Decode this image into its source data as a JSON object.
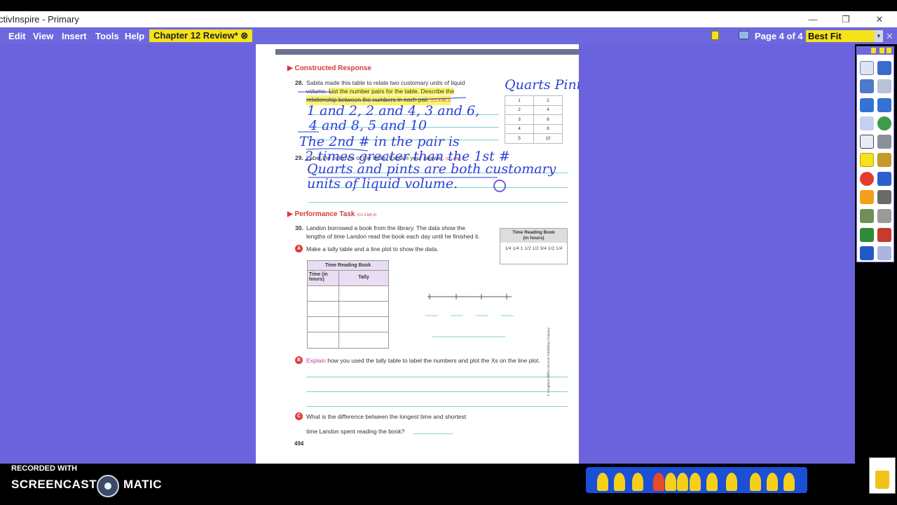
{
  "window": {
    "title": "ctivInspire - Primary",
    "minimize_glyph": "—",
    "restore_glyph": "❐",
    "close_glyph": "✕"
  },
  "menu": {
    "items": [
      "Edit",
      "View",
      "Insert",
      "Tools",
      "Help"
    ],
    "document_tab": "Chapter 12 Review*",
    "page_indicator": "Page 4 of 4",
    "zoom_value": "Best Fit",
    "accent_color": "#6e68de",
    "highlight_color": "#f4e21a"
  },
  "worksheet": {
    "section1_title": "Constructed Response",
    "q28_num": "28.",
    "q28_line1": "Sabita made this table to relate two customary units of liquid",
    "q28_line2a": "volume.",
    "q28_line2b": "List the number pairs for the table. Describe the",
    "q28_line3": "relationship between the numbers in each pair.",
    "q28_std": "(CC.4.MD.1)",
    "q29_num": "29.",
    "q29_text": "Label the columns of the table. Explain your answer.",
    "q29_std": "(CC.4.MD.1)",
    "table28": [
      [
        "1",
        "2"
      ],
      [
        "2",
        "4"
      ],
      [
        "3",
        "6"
      ],
      [
        "4",
        "8"
      ],
      [
        "5",
        "10"
      ]
    ],
    "section2_title": "Performance Task",
    "section2_std": "(CC.4.MD.4)",
    "q30_num": "30.",
    "q30_line1": "Landon borrowed a book from the library. The data show the",
    "q30_line2": "lengths of time Landon read the book each day until he finished it.",
    "partA_letter": "A",
    "partA_text": "Make a tally table and a line plot to show the data.",
    "time_box_title": "Time Reading Book",
    "time_box_sub": "(in hours)",
    "time_box_values": "1/4  1/4  1  1/2  1/2  3/4  1/2  1/4",
    "tally_title": "Time Reading Book",
    "tally_col1": "Time (in hours)",
    "tally_col2": "Tally",
    "partB_letter": "B",
    "partB_lead": "Explain",
    "partB_text": "how you used the tally table to label the numbers and plot the Xs on the line plot.",
    "partC_letter": "C",
    "partC_line1": "What is the difference between the longest time and shortest",
    "partC_line2": "time Landon spent reading the book?",
    "page_number": "494",
    "copyright": "© Houghton Mifflin Harcourt Publishing Company"
  },
  "handwriting": {
    "header": "Quarts Pints",
    "line1": "1 and 2, 2 and 4, 3 and 6,",
    "line2": "4 and 8, 5 and 10",
    "line3": "The 2nd # in the pair is",
    "line4": "2 times greater than the 1st #",
    "line5": "Quarts and pints are both customary",
    "line6": "units of liquid volume.",
    "ink_color": "#2a3fd8"
  },
  "recorder": {
    "line1": "RECORDED WITH",
    "brand_left": "SCREENCAST",
    "brand_right": "MATIC"
  }
}
